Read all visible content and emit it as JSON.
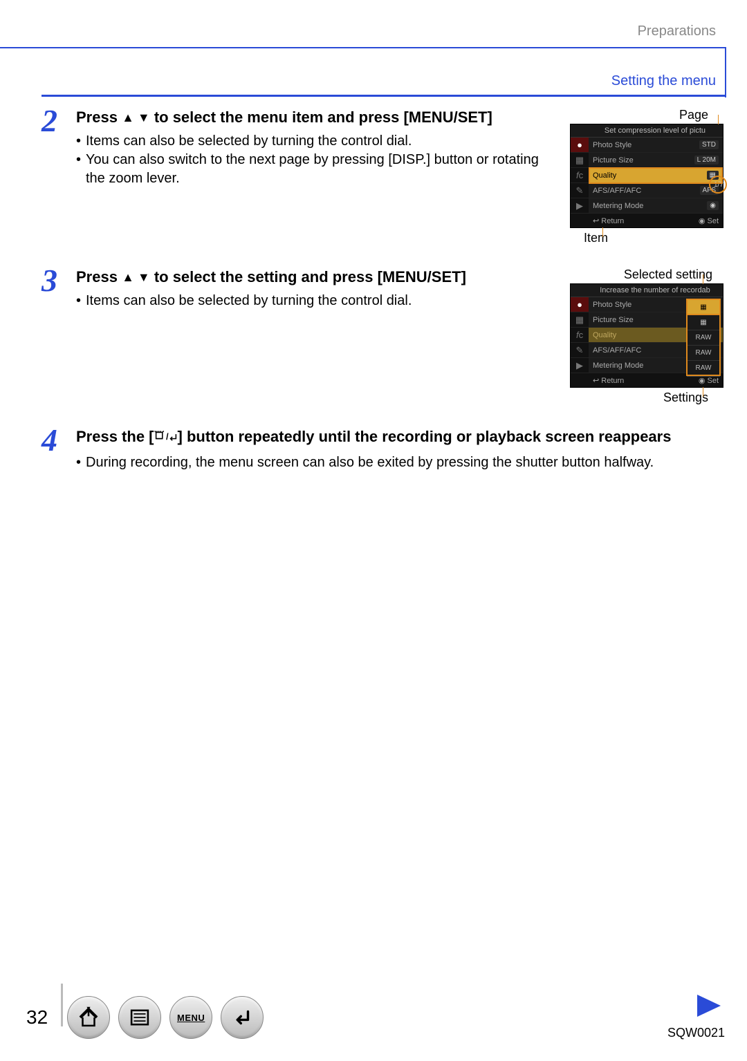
{
  "header": {
    "section": "Preparations",
    "subsection": "Setting the menu"
  },
  "steps": {
    "s2": {
      "num": "2",
      "title_pre": "Press ",
      "title_post": " to select the menu item and press [MENU/SET]",
      "bullets": [
        "Items can also be selected by turning the control dial.",
        "You can also switch to the next page by pressing [DISP.] button or rotating the zoom lever."
      ],
      "fig": {
        "label_top": "Page",
        "label_bottom": "Item",
        "header": "Set compression level of pictu",
        "rows": [
          {
            "label": "Photo Style",
            "val": "STD"
          },
          {
            "label": "Picture Size",
            "val": "L 20M"
          },
          {
            "label": "Quality",
            "val": ""
          },
          {
            "label": "AFS/AFF/AFC",
            "val": "AFS"
          },
          {
            "label": "Metering Mode",
            "val": ""
          }
        ],
        "page_indicator": "1/7",
        "foot_left": "Return",
        "foot_right": "Set"
      }
    },
    "s3": {
      "num": "3",
      "title_pre": "Press ",
      "title_post": " to select the setting and press [MENU/SET]",
      "bullets": [
        "Items can also be selected by turning the control dial."
      ],
      "fig": {
        "label_top": "Selected setting",
        "label_bottom": "Settings",
        "header": "Increase the number of recordab",
        "rows": [
          {
            "label": "Photo Style"
          },
          {
            "label": "Picture Size"
          },
          {
            "label": "Quality"
          },
          {
            "label": "AFS/AFF/AFC"
          },
          {
            "label": "Metering Mode"
          }
        ],
        "options": [
          "",
          "",
          "RAW",
          "RAW",
          "RAW"
        ],
        "foot_left": "Return",
        "foot_right": "Set"
      }
    },
    "s4": {
      "num": "4",
      "title_pre": "Press the [",
      "title_post": "] button repeatedly until the recording or playback screen reappears",
      "bullets": [
        "During recording, the menu screen can also be exited by pressing the shutter button halfway."
      ]
    }
  },
  "footer": {
    "page_number": "32",
    "buttons": {
      "home": "home-icon",
      "toc": "toc-icon",
      "menu_label": "MENU",
      "back": "back-icon"
    },
    "doc_code": "SQW0021"
  }
}
